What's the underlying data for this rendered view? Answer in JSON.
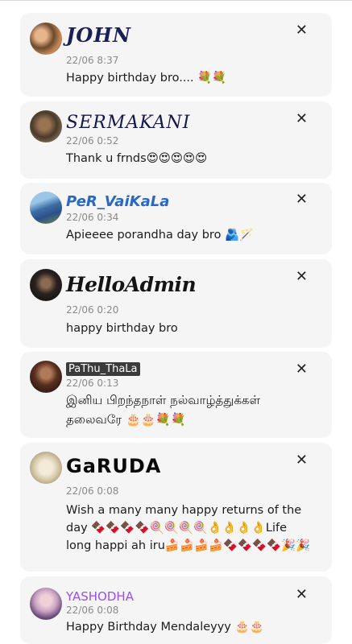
{
  "comments": [
    {
      "name": "JOHN",
      "time": "22/06 8:37",
      "message": "Happy birthday bro.... 💐💐"
    },
    {
      "name": "SERMAKANI",
      "time": "22/06 0:52",
      "message": "Thank u frnds😍😍😍😍😍"
    },
    {
      "name": "PeR_VaiKaLa",
      "time": "22/06 0:34",
      "message": "Apieeee porandha day bro 🫂🪄"
    },
    {
      "name": "HelloAdmin",
      "time": "22/06 0:20",
      "message": "happy birthday bro"
    },
    {
      "name": "PaThu_ThaLa",
      "time": "22/06 0:13",
      "message": "இனிய பிறந்தநாள் நல்வாழ்த்துக்கள் தலைவரே 🎂🎂💐💐"
    },
    {
      "name": "GaRUDA",
      "time": "22/06 0:08",
      "message": "Wish a many many happy returns of the day 🍫🍫🍫🍫🍭🍭🍭🍭👌👌👌👌Life long happi ah iru🍰🍰🍰🍰🍫🍫🍫🍫🎉🎉"
    },
    {
      "name": "YASHODHA",
      "time": "22/06 0:08",
      "message": "Happy Birthday Mendaleyyy 🎂🎂"
    }
  ],
  "colors": {
    "card_background": "#f5f5f5",
    "timestamp": "#8a8a8a",
    "per_name": "#2a68c6",
    "yashodha_name": "#9a4fe8"
  },
  "icons": {
    "close": "close-icon"
  }
}
